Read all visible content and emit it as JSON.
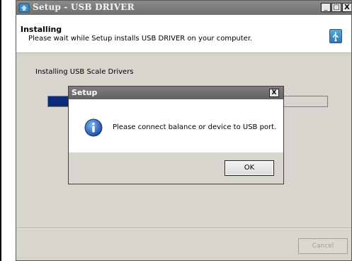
{
  "window": {
    "title": "Setup - USB DRIVER",
    "controls": {
      "minimize": "_",
      "maximize": "□",
      "close": "X"
    }
  },
  "header": {
    "title": "Installing",
    "subtitle": "Please wait while Setup installs USB DRIVER on your computer.",
    "icon": "usb-installer-icon"
  },
  "body": {
    "status": "Installing USB Scale Drivers",
    "progress": 0.08
  },
  "footer": {
    "cancel_label": "Cancel"
  },
  "dialog": {
    "title": "Setup",
    "close": "X",
    "icon": "info-icon",
    "message": "Please connect balance or device to USB port.",
    "ok_label": "OK"
  },
  "colors": {
    "titlebar": "#6e6e6e",
    "progress_fill": "#0b2a7a",
    "window_bg": "#d8d5ce",
    "info_icon": "#2a64b8"
  }
}
